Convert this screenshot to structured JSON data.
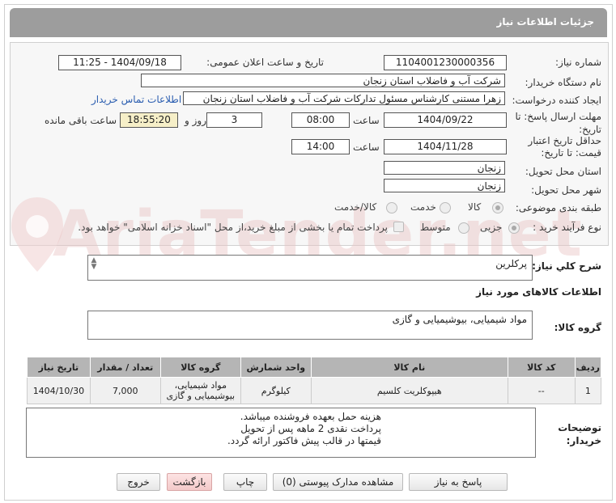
{
  "header": {
    "title": "جزئیات اطلاعات نیاز"
  },
  "form": {
    "need_number_label": "شماره نیاز:",
    "need_number": "1104001230000356",
    "announce_label": "تاریخ و ساعت اعلان عمومی:",
    "announce_value": "1404/09/18 - 11:25",
    "buyer_org_label": "نام دستگاه خریدار:",
    "buyer_org": "شرکت آب و فاضلاب استان زنجان",
    "creator_label": "ایجاد کننده درخواست:",
    "creator": "زهرا مستنی کارشناس مسئول تدارکات شرکت آب و فاضلاب استان زنجان",
    "contact_link": "اطلاعات تماس خریدار",
    "deadline_label_1": "مهلت ارسال پاسخ: تا",
    "deadline_label_2": "تاریخ:",
    "deadline_date": "1404/09/22",
    "time_label": "ساعت",
    "deadline_time": "08:00",
    "days_value": "3",
    "days_label": "روز و",
    "remaining_time": "18:55:20",
    "remaining_label": "ساعت باقی مانده",
    "validity_label_1": "حداقل تاریخ اعتبار",
    "validity_label_2": "قیمت: تا تاریخ:",
    "validity_date": "1404/11/28",
    "validity_time": "14:00",
    "province_label": "استان محل تحویل:",
    "province": "زنجان",
    "city_label": "شهر محل تحویل:",
    "city": "زنجان",
    "category_label": "طبقه بندی موضوعی:",
    "category_options": [
      "کالا",
      "خدمت",
      "کالا/خدمت"
    ],
    "category_selected": "کالا",
    "process_label": "نوع فرآیند خرید :",
    "process_options": [
      "جزیی",
      "متوسط"
    ],
    "process_selected": "جزیی",
    "treasury_note": "پرداخت تمام یا بخشی از مبلغ خرید،از محل \"اسناد خزانه اسلامی\" خواهد بود."
  },
  "watermark": "AriaTender.net",
  "summary": {
    "label": "شرح کلي نياز:",
    "value": "پرکلرین"
  },
  "goods": {
    "section_title": "اطلاعات کالاهای مورد نیاز",
    "group_label": "گروه کالا:",
    "group_value": "مواد شیمیایی، بیوشیمیایی و  گازی"
  },
  "table": {
    "headers": [
      "ردیف",
      "کد کالا",
      "نام کالا",
      "واحد شمارش",
      "گروه کالا",
      "تعداد / مقدار",
      "تاریخ نیاز"
    ],
    "rows": [
      [
        "1",
        "--",
        "هیپوکلریت کلسیم",
        "کیلوگرم",
        "مواد شیمیایی، بیوشیمیایی و گازی",
        "7,000",
        "1404/10/30"
      ]
    ]
  },
  "notes": {
    "label_1": "توضیحات",
    "label_2": "خریدار:",
    "lines": [
      "هزینه حمل بعهده فروشنده میباشد.",
      "پرداخت نقدی 2 ماهه پس از تحویل",
      "قیمتها در قالب پیش فاکتور ارائه گردد."
    ]
  },
  "buttons": {
    "reply": "پاسخ به نیاز",
    "docs": "مشاهده مدارک پیوستی (0)",
    "print": "چاپ",
    "back": "بازگشت",
    "exit": "خروج"
  }
}
